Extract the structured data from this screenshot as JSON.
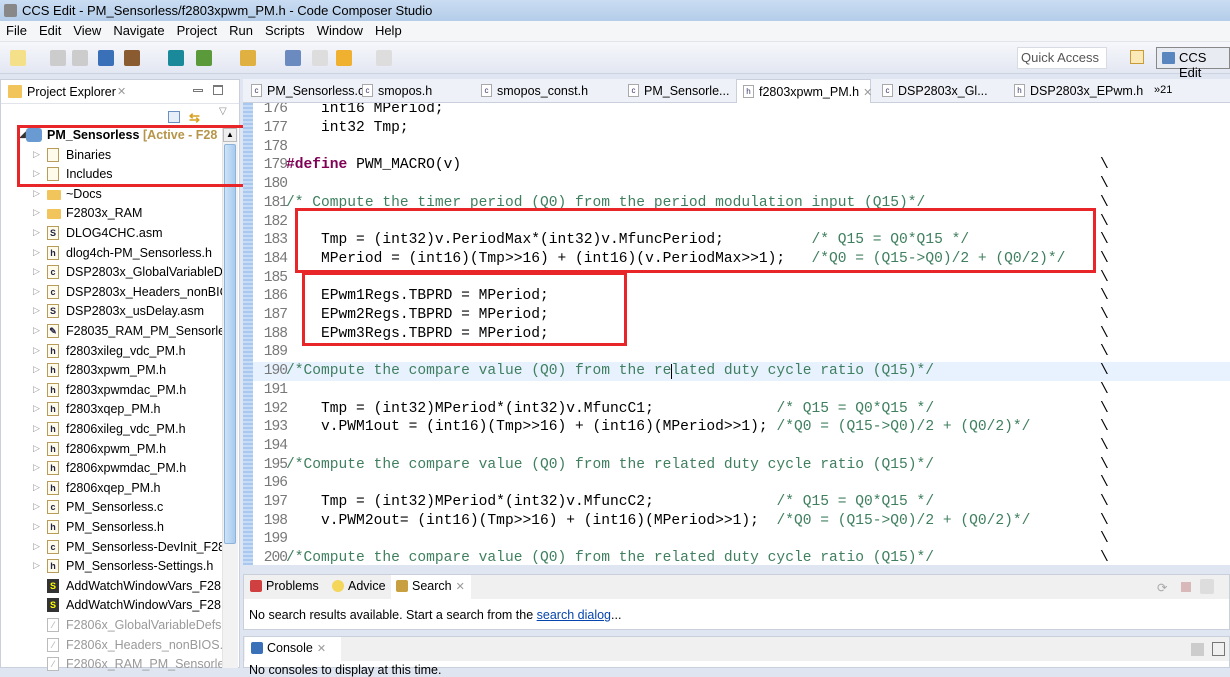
{
  "window": {
    "title": "CCS Edit - PM_Sensorless/f2803xpwm_PM.h - Code Composer Studio"
  },
  "menu": [
    "File",
    "Edit",
    "View",
    "Navigate",
    "Project",
    "Run",
    "Scripts",
    "Window",
    "Help"
  ],
  "toolbar": {
    "quick_access_placeholder": "Quick Access",
    "perspective": "CCS Edit",
    "icons": [
      "new-icon",
      "save-icon",
      "save-all-icon",
      "terminal-icon",
      "build-hammer-icon",
      "search-icon",
      "debug-bug-icon",
      "flash-icon",
      "page-icon",
      "back-disabled-icon",
      "back-arrow-icon",
      "forward-arrow-icon",
      "open-perspective-icon"
    ]
  },
  "project_explorer": {
    "title": "Project Explorer",
    "project": {
      "name": "PM_Sensorless",
      "status": "[Active - F28"
    },
    "items": [
      {
        "label": "Binaries",
        "icon": "binaries-icon",
        "kind": "special"
      },
      {
        "label": "Includes",
        "icon": "includes-icon",
        "kind": "special"
      },
      {
        "label": "~Docs",
        "icon": "folder-icon",
        "kind": "folder"
      },
      {
        "label": "F2803x_RAM",
        "icon": "folder-icon",
        "kind": "folder"
      },
      {
        "label": "DLOG4CHC.asm",
        "icon": "S",
        "kind": "file"
      },
      {
        "label": "dlog4ch-PM_Sensorless.h",
        "icon": "h",
        "kind": "file"
      },
      {
        "label": "DSP2803x_GlobalVariableD",
        "icon": "c",
        "kind": "file"
      },
      {
        "label": "DSP2803x_Headers_nonBIC",
        "icon": "c",
        "kind": "file"
      },
      {
        "label": "DSP2803x_usDelay.asm",
        "icon": "S",
        "kind": "file"
      },
      {
        "label": "F28035_RAM_PM_Sensorles",
        "icon": "cmd",
        "kind": "file"
      },
      {
        "label": "f2803xileg_vdc_PM.h",
        "icon": "h",
        "kind": "file"
      },
      {
        "label": "f2803xpwm_PM.h",
        "icon": "h",
        "kind": "file"
      },
      {
        "label": "f2803xpwmdac_PM.h",
        "icon": "h",
        "kind": "file"
      },
      {
        "label": "f2803xqep_PM.h",
        "icon": "h",
        "kind": "file"
      },
      {
        "label": "f2806xileg_vdc_PM.h",
        "icon": "h",
        "kind": "file"
      },
      {
        "label": "f2806xpwm_PM.h",
        "icon": "h",
        "kind": "file"
      },
      {
        "label": "f2806xpwmdac_PM.h",
        "icon": "h",
        "kind": "file"
      },
      {
        "label": "f2806xqep_PM.h",
        "icon": "h",
        "kind": "file"
      },
      {
        "label": "PM_Sensorless.c",
        "icon": "c",
        "kind": "file"
      },
      {
        "label": "PM_Sensorless.h",
        "icon": "h",
        "kind": "file"
      },
      {
        "label": "PM_Sensorless-DevInit_F28",
        "icon": "c",
        "kind": "file"
      },
      {
        "label": "PM_Sensorless-Settings.h",
        "icon": "h",
        "kind": "file"
      },
      {
        "label": "AddWatchWindowVars_F28",
        "icon": "script",
        "kind": "script"
      },
      {
        "label": "AddWatchWindowVars_F28",
        "icon": "script",
        "kind": "script"
      },
      {
        "label": "F2806x_GlobalVariableDefs",
        "icon": "excluded",
        "kind": "disabled"
      },
      {
        "label": "F2806x_Headers_nonBIOS.c",
        "icon": "excluded",
        "kind": "disabled"
      },
      {
        "label": "F2806x_RAM_PM_Sensorles",
        "icon": "excluded",
        "kind": "disabled"
      }
    ]
  },
  "editor": {
    "tabs": [
      {
        "label": "PM_Sensorless.c",
        "icon": "c"
      },
      {
        "label": "smopos.h",
        "icon": "c"
      },
      {
        "label": "smopos_const.h",
        "icon": "c"
      },
      {
        "label": "PM_Sensorle...",
        "icon": "c"
      },
      {
        "label": "f2803xpwm_PM.h",
        "icon": "h",
        "active": true
      },
      {
        "label": "DSP2803x_Gl...",
        "icon": "c"
      },
      {
        "label": "DSP2803x_EPwm.h",
        "icon": "h"
      }
    ],
    "overflow": "»21",
    "lines": [
      {
        "n": "176",
        "code": "    int16 MPeriod;",
        "type": "decl"
      },
      {
        "n": "177",
        "code": "    int32 Tmp;",
        "type": "decl"
      },
      {
        "n": "178",
        "code": ""
      },
      {
        "n": "179",
        "kw": "#define",
        "code": " PWM_MACRO(v)",
        "bs": true
      },
      {
        "n": "180",
        "code": "",
        "bs": true
      },
      {
        "n": "181",
        "comment": "/* Compute the timer period (Q0) from the period modulation input (Q15)*/",
        "bs": true
      },
      {
        "n": "182",
        "code": "",
        "bs": true
      },
      {
        "n": "183",
        "code": "    Tmp = (int32)v.PeriodMax*(int32)v.MfuncPeriod;          ",
        "comment": "/* Q15 = Q0*Q15 */",
        "bs": true
      },
      {
        "n": "184",
        "code": "    MPeriod = (int16)(Tmp>>16) + (int16)(v.PeriodMax>>1);   ",
        "comment": "/*Q0 = (Q15->Q0)/2 + (Q0/2)*/",
        "bs": true
      },
      {
        "n": "185",
        "code": "",
        "bs": true
      },
      {
        "n": "186",
        "code": "    EPwm1Regs.TBPRD = MPeriod;",
        "bs": true
      },
      {
        "n": "187",
        "code": "    EPwm2Regs.TBPRD = MPeriod;",
        "bs": true
      },
      {
        "n": "188",
        "code": "    EPwm3Regs.TBPRD = MPeriod;",
        "bs": true
      },
      {
        "n": "189",
        "code": "",
        "bs": true
      },
      {
        "n": "190",
        "comment": "/*Compute the compare value (Q0) from the related duty cycle ratio (Q15)*/",
        "bs": true,
        "current": true
      },
      {
        "n": "191",
        "code": "",
        "bs": true
      },
      {
        "n": "192",
        "code": "    Tmp = (int32)MPeriod*(int32)v.MfuncC1;              ",
        "comment": "/* Q15 = Q0*Q15 */",
        "bs": true
      },
      {
        "n": "193",
        "code": "    v.PWM1out = (int16)(Tmp>>16) + (int16)(MPeriod>>1); ",
        "comment": "/*Q0 = (Q15->Q0)/2 + (Q0/2)*/",
        "bs": true
      },
      {
        "n": "194",
        "code": "",
        "bs": true
      },
      {
        "n": "195",
        "comment": "/*Compute the compare value (Q0) from the related duty cycle ratio (Q15)*/",
        "bs": true
      },
      {
        "n": "196",
        "code": "",
        "bs": true
      },
      {
        "n": "197",
        "code": "    Tmp = (int32)MPeriod*(int32)v.MfuncC2;              ",
        "comment": "/* Q15 = Q0*Q15 */",
        "bs": true
      },
      {
        "n": "198",
        "code": "    v.PWM2out= (int16)(Tmp>>16) + (int16)(MPeriod>>1);  ",
        "comment": "/*Q0 = (Q15->Q0)/2 + (Q0/2)*/",
        "bs": true
      },
      {
        "n": "199",
        "code": "",
        "bs": true
      },
      {
        "n": "200",
        "comment": "/*Compute the compare value (Q0) from the related duty cycle ratio (Q15)*/",
        "bs": true
      }
    ],
    "backslash": "\\"
  },
  "search_panel": {
    "tabs": [
      "Problems",
      "Advice",
      "Search"
    ],
    "message": "No search results available. Start a search from the ",
    "link": "search dialog",
    "suffix": "..."
  },
  "console_panel": {
    "tab": "Console",
    "message": "No consoles to display at this time."
  },
  "colors": {
    "highlight_box": "#e8262a",
    "comment": "#3f7f5f",
    "keyword": "#7f0055",
    "current_line": "#e8f2fe"
  }
}
